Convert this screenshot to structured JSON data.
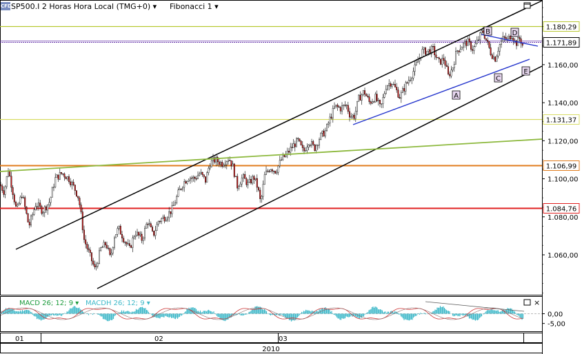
{
  "header": {
    "badge": "CFD",
    "symbol_title": "SP500.I 2 Horas Hora Local (TMG+0)",
    "study": "Fibonacci 1"
  },
  "colors": {
    "fib_top": "#b8c832",
    "fib_upper_mid": "#d8dc64",
    "fib_mid": "#e07b1c",
    "fib_low": "#e02020",
    "trend_green": "#8cb83c",
    "channel": "#000000",
    "triangle": "#2233cc",
    "candle_up": "#ffffff",
    "candle_down": "#cc2222",
    "macd": "#cc3333",
    "macdh": "#3cb8c8",
    "price_line": "#6633aa"
  },
  "chart_data": [
    {
      "type": "candlestick",
      "title": "SP500.I 2 Horas Hora Local (TMG+0)",
      "x_ticks": [
        "01",
        "02",
        "03"
      ],
      "x_year": "2010",
      "y_ticks": [
        1060,
        1080,
        1100,
        1120,
        1140,
        1160
      ],
      "y_tick_labels": [
        "1.060,00",
        "1.080,00",
        "1.100,00",
        "1.120,00",
        "1.140,00",
        "1.160,00"
      ],
      "ylim": [
        1039,
        1194
      ],
      "current_price": 1171.89,
      "current_price_label": "1.171,89",
      "fib_levels": [
        {
          "value": 1180.29,
          "label": "1.180,29",
          "color": "#b8c832"
        },
        {
          "value": 1131.37,
          "label": "1.131,37",
          "color": "#d8dc64"
        },
        {
          "value": 1106.99,
          "label": "1.106,99",
          "color": "#e07b1c"
        },
        {
          "value": 1084.76,
          "label": "1.084,76",
          "color": "#e02020"
        }
      ],
      "wave_labels": [
        "A",
        "B",
        "C",
        "D",
        "E"
      ],
      "path": [
        [
          0,
          1097
        ],
        [
          6,
          1093
        ],
        [
          12,
          1105
        ],
        [
          16,
          1098
        ],
        [
          24,
          1083
        ],
        [
          32,
          1092
        ],
        [
          42,
          1075
        ],
        [
          52,
          1087
        ],
        [
          62,
          1083
        ],
        [
          72,
          1088
        ],
        [
          80,
          1100
        ],
        [
          90,
          1103
        ],
        [
          100,
          1100
        ],
        [
          108,
          1095
        ],
        [
          114,
          1090
        ],
        [
          118,
          1080
        ],
        [
          122,
          1068
        ],
        [
          130,
          1060
        ],
        [
          138,
          1052
        ],
        [
          146,
          1063
        ],
        [
          154,
          1066
        ],
        [
          160,
          1058
        ],
        [
          166,
          1070
        ],
        [
          172,
          1074
        ],
        [
          180,
          1068
        ],
        [
          188,
          1063
        ],
        [
          196,
          1072
        ],
        [
          206,
          1068
        ],
        [
          214,
          1078
        ],
        [
          222,
          1070
        ],
        [
          230,
          1078
        ],
        [
          240,
          1080
        ],
        [
          250,
          1084
        ],
        [
          258,
          1092
        ],
        [
          266,
          1098
        ],
        [
          274,
          1101
        ],
        [
          282,
          1100
        ],
        [
          290,
          1103
        ],
        [
          298,
          1099
        ],
        [
          304,
          1108
        ],
        [
          312,
          1110
        ],
        [
          322,
          1108
        ],
        [
          332,
          1111
        ],
        [
          338,
          1106
        ],
        [
          344,
          1096
        ],
        [
          352,
          1101
        ],
        [
          360,
          1097
        ],
        [
          368,
          1101
        ],
        [
          374,
          1095
        ],
        [
          378,
          1087
        ],
        [
          384,
          1102
        ],
        [
          392,
          1106
        ],
        [
          400,
          1104
        ],
        [
          408,
          1110
        ],
        [
          416,
          1113
        ],
        [
          424,
          1117
        ],
        [
          432,
          1120
        ],
        [
          440,
          1114
        ],
        [
          448,
          1120
        ],
        [
          456,
          1116
        ],
        [
          464,
          1122
        ],
        [
          472,
          1125
        ],
        [
          480,
          1133
        ],
        [
          486,
          1138
        ],
        [
          494,
          1137
        ],
        [
          502,
          1139
        ],
        [
          508,
          1133
        ],
        [
          514,
          1133
        ],
        [
          520,
          1142
        ],
        [
          528,
          1146
        ],
        [
          536,
          1140
        ],
        [
          544,
          1143
        ],
        [
          552,
          1137
        ],
        [
          560,
          1149
        ],
        [
          568,
          1151
        ],
        [
          574,
          1147
        ],
        [
          580,
          1143
        ],
        [
          588,
          1149
        ],
        [
          596,
          1154
        ],
        [
          604,
          1160
        ],
        [
          612,
          1167
        ],
        [
          620,
          1167
        ],
        [
          628,
          1168
        ],
        [
          636,
          1161
        ],
        [
          644,
          1163
        ],
        [
          650,
          1154
        ],
        [
          656,
          1158
        ],
        [
          662,
          1167
        ],
        [
          670,
          1170
        ],
        [
          678,
          1172
        ],
        [
          686,
          1168
        ],
        [
          692,
          1172
        ],
        [
          700,
          1178
        ],
        [
          706,
          1172
        ],
        [
          712,
          1166
        ],
        [
          718,
          1163
        ],
        [
          724,
          1170
        ],
        [
          730,
          1174
        ],
        [
          736,
          1173
        ],
        [
          742,
          1176
        ],
        [
          748,
          1171
        ],
        [
          754,
          1174
        ],
        [
          760,
          1168
        ]
      ]
    },
    {
      "type": "line",
      "series": [
        {
          "name": "MACD 26; 12; 9",
          "label": "MACD 26; 12; 9 ▾"
        },
        {
          "name": "MACDH 26; 12; 9",
          "label": "MACDH 26; 12; 9 ▾"
        }
      ],
      "y_ticks": [
        0,
        -5
      ],
      "y_tick_labels": [
        "0,00",
        "-5,00"
      ],
      "ylim": [
        -9,
        9
      ]
    }
  ]
}
